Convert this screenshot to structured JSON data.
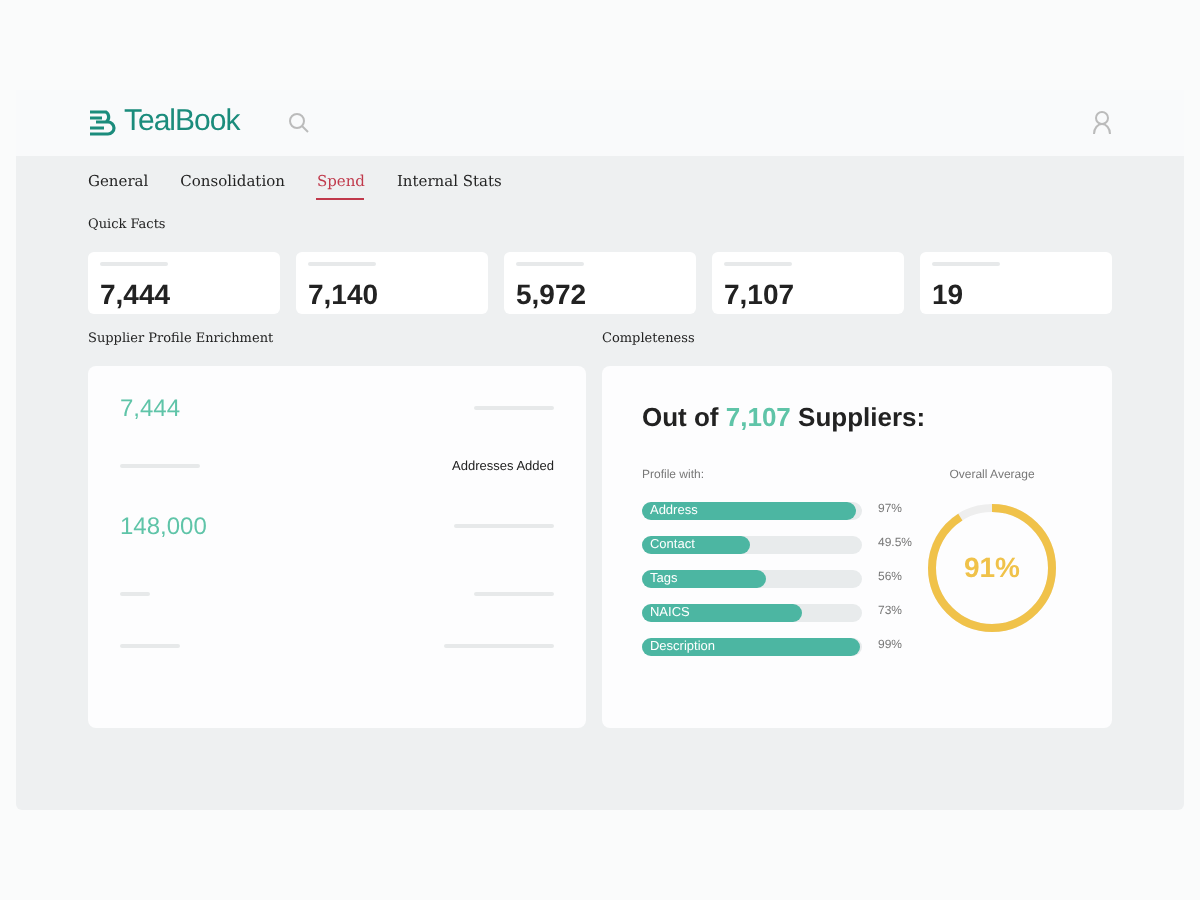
{
  "header": {
    "logo": "TealBook"
  },
  "tabs": [
    {
      "label": "General",
      "selected": false
    },
    {
      "label": "Consolidation",
      "selected": false
    },
    {
      "label": "Spend",
      "selected": true
    },
    {
      "label": "Internal Stats",
      "selected": false
    }
  ],
  "quick_facts": {
    "title": "Quick Facts",
    "cards": [
      {
        "value": "7,444"
      },
      {
        "value": "7,140"
      },
      {
        "value": "5,972"
      },
      {
        "value": "7,107"
      },
      {
        "value": "19"
      }
    ]
  },
  "enrichment": {
    "title": "Supplier Profile Enrichment",
    "first_value": "7,444",
    "label": "Addresses Added",
    "second_value": "148,000"
  },
  "completeness": {
    "title": "Completeness",
    "heading_prefix": "Out of",
    "heading_number": "7,107",
    "heading_suffix": "Suppliers:",
    "subtitle": "Profile with:",
    "bars": [
      {
        "label": "Address",
        "level": 0.97,
        "reading": "97%"
      },
      {
        "label": "Contact",
        "level": 0.495,
        "reading": "49.5%"
      },
      {
        "label": "Tags",
        "level": 0.56,
        "reading": "56%"
      },
      {
        "label": "NAICS",
        "level": 0.73,
        "reading": "73%"
      },
      {
        "label": "Description",
        "level": 0.99,
        "reading": "99%"
      }
    ],
    "average": {
      "label": "Overall Average",
      "value": "91%"
    }
  }
}
